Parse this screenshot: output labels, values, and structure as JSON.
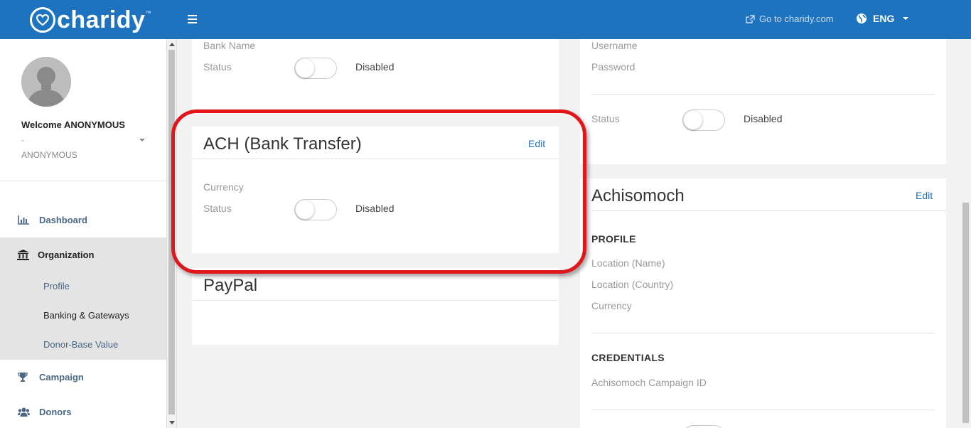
{
  "header": {
    "brand": "charidy",
    "goto_link": "Go to charidy.com",
    "language": "ENG"
  },
  "sidebar": {
    "welcome": "Welcome ANONYMOUS",
    "dash": "-",
    "role": "ANONYMOUS",
    "nav": {
      "dashboard": "Dashboard",
      "organization": "Organization",
      "campaign": "Campaign",
      "donors": "Donors"
    },
    "org_sub": {
      "profile": "Profile",
      "banking": "Banking & Gateways",
      "donor_base": "Donor-Base Value"
    }
  },
  "bank_card": {
    "bank_name_label": "Bank Name",
    "status_label": "Status",
    "status_value": "Disabled"
  },
  "ach_card": {
    "title": "ACH (Bank Transfer)",
    "edit": "Edit",
    "currency_label": "Currency",
    "status_label": "Status",
    "status_value": "Disabled"
  },
  "paypal_card": {
    "title": "PayPal"
  },
  "right_top_card": {
    "username_label": "Username",
    "password_label": "Password",
    "status_label": "Status",
    "status_value": "Disabled"
  },
  "achisomoch_card": {
    "title": "Achisomoch",
    "edit": "Edit",
    "profile_heading": "PROFILE",
    "location_name_label": "Location (Name)",
    "location_country_label": "Location (Country)",
    "currency_label": "Currency",
    "credentials_heading": "CREDENTIALS",
    "campaign_id_label": "Achisomoch Campaign ID"
  },
  "colors": {
    "topbar": "#1e73be",
    "highlight": "#e0161b",
    "link": "#1e73be"
  }
}
